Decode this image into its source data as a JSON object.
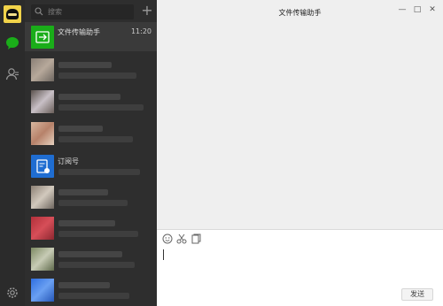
{
  "search": {
    "placeholder": "搜索"
  },
  "add_label": "+",
  "contacts": [
    {
      "name": "文件传输助手",
      "time": "11:20"
    },
    {
      "name": "订阅号"
    }
  ],
  "chat": {
    "title": "文件传输助手",
    "minimize_label": "—",
    "maximize_label": "□",
    "close_label": "✕"
  },
  "composer": {
    "send_label": "发送"
  },
  "colors": {
    "rail_bg": "#2b2b2b",
    "list_bg": "#2e2e2e",
    "accent_green": "#1aad19",
    "subscription_blue": "#1f6dd1"
  },
  "icons": [
    "chat-icon",
    "contacts-icon",
    "settings-icon",
    "search-icon",
    "emoji-icon",
    "scissors-icon",
    "folder-icon"
  ]
}
